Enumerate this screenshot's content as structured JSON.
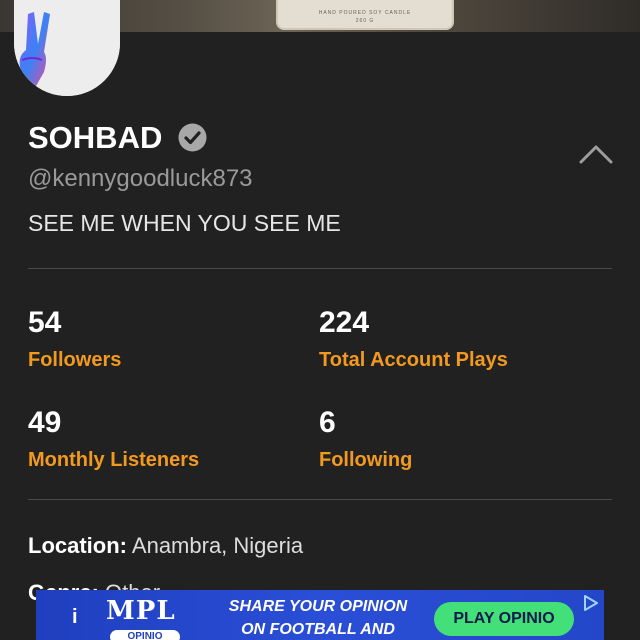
{
  "cover": {
    "label_line1": "HAND POURED SOY CANDLE",
    "label_line2": "260 G"
  },
  "profile": {
    "name": "SOHBAD",
    "handle": "@kennygoodluck873",
    "bio": "SEE ME WHEN YOU SEE ME",
    "verified": true
  },
  "stats": [
    {
      "value": "54",
      "label": "Followers"
    },
    {
      "value": "224",
      "label": "Total Account Plays"
    },
    {
      "value": "49",
      "label": "Monthly Listeners"
    },
    {
      "value": "6",
      "label": "Following"
    }
  ],
  "details": {
    "location_key": "Location:",
    "location_value": "Anambra, Nigeria",
    "genre_key": "Genre:",
    "genre_value": "Other"
  },
  "ad": {
    "info": "i",
    "logo": "MPL",
    "logo_sub": "OPINIO",
    "line1": "SHARE YOUR OPINION",
    "line2": "ON FOOTBALL AND",
    "cta": "PLAY OPINIO"
  },
  "colors": {
    "background": "#212121",
    "accent": "#f39a1e",
    "ad_background": "#2447c9",
    "ad_cta": "#43e07a"
  },
  "icons": {
    "verified": "verified-check-icon",
    "collapse": "chevron-up-icon",
    "ad_choices": "ad-choices-icon"
  }
}
